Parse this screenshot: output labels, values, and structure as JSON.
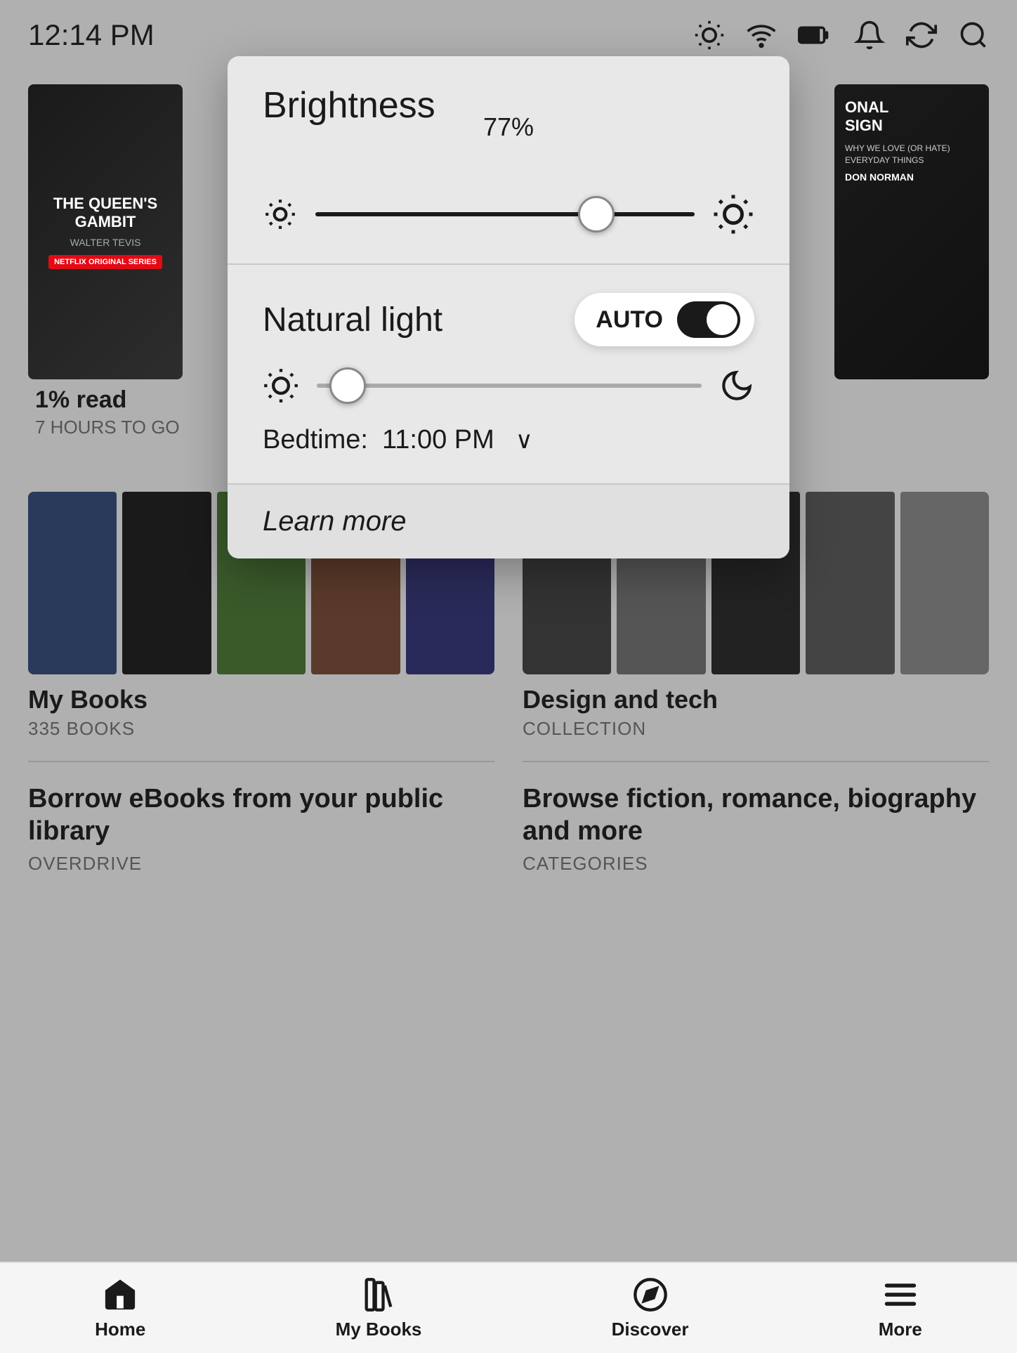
{
  "statusBar": {
    "time": "12:14 PM"
  },
  "brightnessPanel": {
    "title": "Brightness",
    "brightnessPercent": "77%",
    "brightnessValue": 74,
    "naturalLight": {
      "label": "Natural light",
      "autoLabel": "AUTO",
      "toggleOn": true,
      "sliderValue": 8
    },
    "bedtime": {
      "label": "Bedtime:",
      "value": "11:00 PM"
    },
    "learnMore": "Learn more"
  },
  "books": {
    "topLeft": {
      "title": "THE QUEEN'S GAMBIT",
      "author": "WALTER TEVIS",
      "badge": "NETFLIX",
      "readPercent": "1% read",
      "hoursLeft": "7 HOURS TO GO"
    },
    "topRight": {
      "title": "ONAL SIGN",
      "subtitle": "WHY WE LOVE (OR HATE) EVERYDAY THINGS",
      "author": "DON NORMAN"
    }
  },
  "sections": {
    "myBooks": {
      "label": "My Books",
      "sublabel": "335 BOOKS"
    },
    "designTech": {
      "label": "Design and tech",
      "sublabel": "COLLECTION"
    },
    "borrowEbooks": {
      "title": "Borrow eBooks from your public library",
      "sublabel": "OVERDRIVE"
    },
    "browseFiction": {
      "title": "Browse fiction, romance, biography and more",
      "sublabel": "CATEGORIES"
    }
  },
  "bottomNav": {
    "items": [
      {
        "label": "Home",
        "icon": "home"
      },
      {
        "label": "My Books",
        "icon": "books"
      },
      {
        "label": "Discover",
        "icon": "compass"
      },
      {
        "label": "More",
        "icon": "menu"
      }
    ],
    "activeIndex": 0
  }
}
